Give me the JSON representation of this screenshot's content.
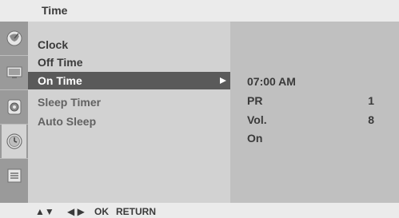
{
  "header": {
    "title": "Time"
  },
  "sidebar": {
    "icons": [
      "satellite-dish-icon",
      "monitor-icon",
      "speaker-icon",
      "clock-icon",
      "menu-list-icon"
    ],
    "active_index": 3
  },
  "menu": {
    "items": [
      {
        "label": "Clock"
      },
      {
        "label": "Off Time"
      },
      {
        "label": "On Time"
      },
      {
        "label": "Sleep Timer"
      },
      {
        "label": "Auto Sleep"
      }
    ],
    "selected_index": 2
  },
  "detail": {
    "time": "07:00 AM",
    "rows": [
      {
        "key": "PR",
        "value": "1"
      },
      {
        "key": "Vol.",
        "value": "8"
      },
      {
        "key": "On",
        "value": ""
      }
    ]
  },
  "footer": {
    "updown": "▲▼",
    "leftright": "◀ ▶",
    "ok": "OK",
    "return": "RETURN"
  }
}
